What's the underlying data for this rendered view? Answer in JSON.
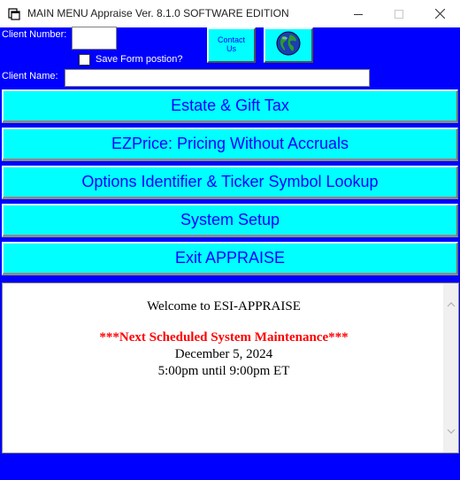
{
  "window": {
    "title": "MAIN MENU Appraise Ver. 8.1.0 SOFTWARE EDITION"
  },
  "form": {
    "client_number_label": "Client Number:",
    "client_number_value": "",
    "save_position_label": "Save Form postion?",
    "save_position_checked": false,
    "client_name_label": "Client Name:",
    "client_name_value": ""
  },
  "toolbar": {
    "contact_label": "Contact\nUs",
    "globe_icon": "globe-icon"
  },
  "menu": {
    "items": [
      {
        "label": "Estate & Gift Tax"
      },
      {
        "label": "EZPrice: Pricing Without Accruals"
      },
      {
        "label": "Options Identifier & Ticker Symbol Lookup"
      },
      {
        "label": "System Setup"
      },
      {
        "label": "Exit APPRAISE"
      }
    ]
  },
  "welcome": {
    "title": "Welcome to ESI-APPRAISE",
    "maintenance_heading": "***Next Scheduled System Maintenance***",
    "date": "December 5, 2024",
    "time": "5:00pm until 9:00pm ET"
  },
  "colors": {
    "panel_bg": "#0000ff",
    "button_bg": "#00ffff",
    "button_text": "#0000ff",
    "maintenance_text": "#ff0000"
  }
}
